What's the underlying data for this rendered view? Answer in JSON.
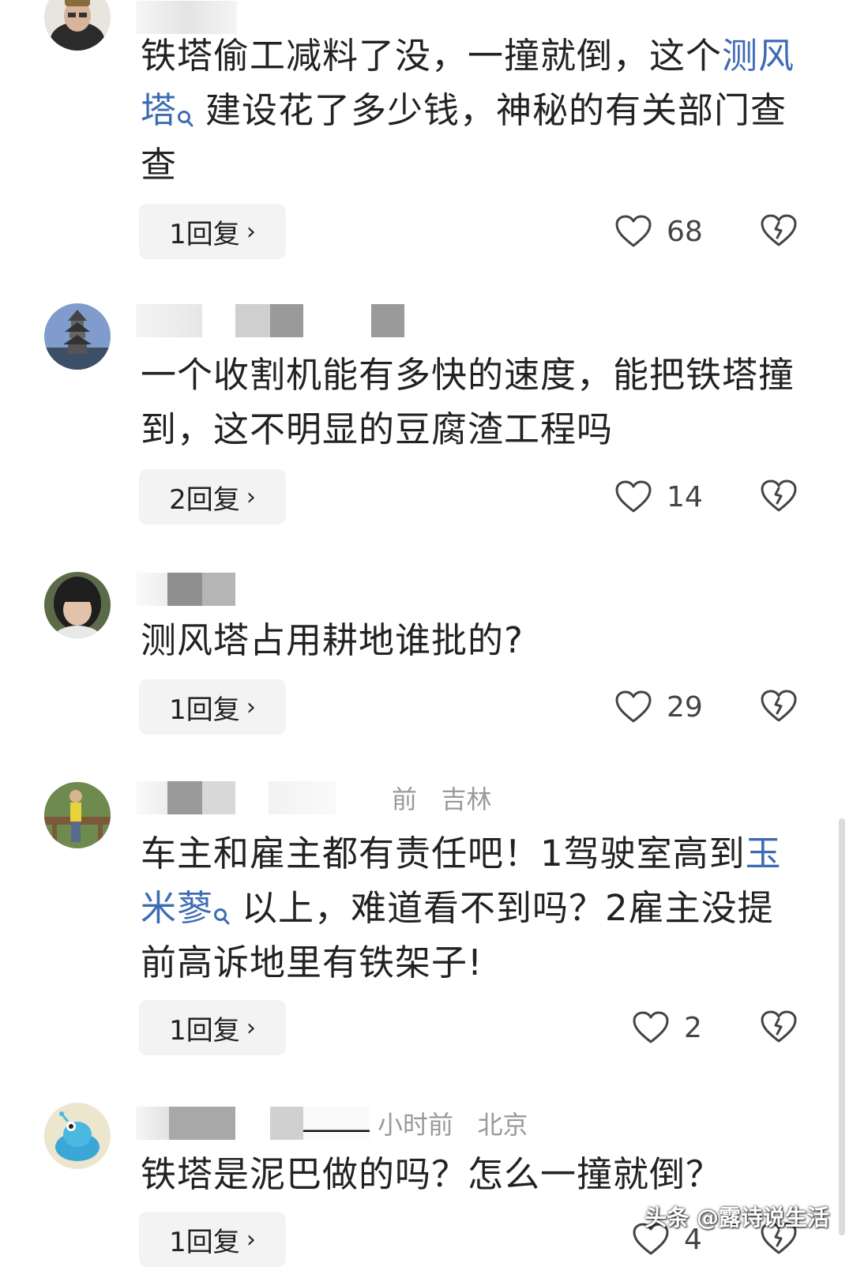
{
  "comments": [
    {
      "meta": "",
      "text_parts": [
        "铁塔偷工减料了没，一撞就倒，这个",
        "测风塔",
        "建设花了多少钱，神秘的有关部门查查"
      ],
      "reply_label": "1回复",
      "likes": "68"
    },
    {
      "meta": "",
      "text": "一个收割机能有多快的速度，能把铁塔撞到，这不明显的豆腐渣工程吗",
      "reply_label": "2回复",
      "likes": "14"
    },
    {
      "meta": "",
      "text": "测风塔占用耕地谁批的?",
      "reply_label": "1回复",
      "likes": "29"
    },
    {
      "meta": "前   吉林",
      "text_parts": [
        "车主和雇主都有责任吧！1驾驶室高到",
        "玉米蓼",
        "以上，难道看不到吗？2雇主没提前高诉地里有铁架子!"
      ],
      "reply_label": "1回复",
      "likes": "2"
    },
    {
      "meta": "小时前   北京",
      "text": "铁塔是泥巴做的吗？怎么一撞就倒？",
      "reply_label": "1回复",
      "likes": "4"
    }
  ],
  "icons": {
    "like": "heart-outline-icon",
    "dislike": "broken-heart-icon",
    "search": "search-icon",
    "chevron": "chevron-right-icon"
  },
  "colors": {
    "link": "#3d6cb5",
    "reply_bg": "#f3f3f3",
    "meta": "#9a9a9a"
  },
  "watermark": "头条 @露诗说生活"
}
